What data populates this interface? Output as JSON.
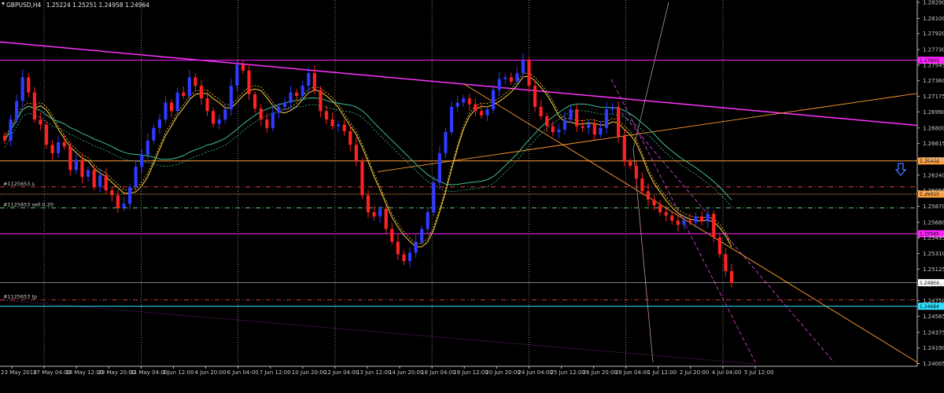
{
  "window": {
    "symbol_timeframe": "GBPUSD,H4",
    "ohlc": "1.25224 1.25251 1.24958 1.24964"
  },
  "chart_data": {
    "type": "candlestick",
    "symbol": "GBPUSD",
    "timeframe": "H4",
    "ylim": [
      1.24,
      1.2829
    ],
    "price_ticks": [
      "1.28290",
      "1.28100",
      "1.27920",
      "1.27730",
      "1.27545",
      "1.27360",
      "1.27175",
      "1.26990",
      "1.26800",
      "1.26615",
      "1.26430",
      "1.26240",
      "1.26055",
      "1.25870",
      "1.25680",
      "1.25495",
      "1.25310",
      "1.25125",
      "1.24940",
      "1.24750",
      "1.24565",
      "1.24375",
      "1.24190",
      "1.24005"
    ],
    "time_ticks": [
      "23 May 2019",
      "27 May 04:00",
      "28 May 12:00",
      "29 May 20:00",
      "31 May 04:00",
      "3 Jun 12:00",
      "4 Jun 20:00",
      "6 Jun 04:00",
      "7 Jun 12:00",
      "10 Jun 20:00",
      "12 Jun 04:00",
      "13 Jun 12:00",
      "14 Jun 20:00",
      "18 Jun 04:00",
      "19 Jun 12:00",
      "20 Jun 20:00",
      "24 Jun 04:00",
      "25 Jun 12:00",
      "26 Jun 20:00",
      "28 Jun 04:00",
      "1 Jul 12:00",
      "2 Jul 20:00",
      "4 Jul 04:00",
      "5 Jul 12:00"
    ],
    "candles_close": [
      1.2665,
      1.269,
      1.2712,
      1.274,
      1.2722,
      1.269,
      1.2684,
      1.266,
      1.265,
      1.2663,
      1.2658,
      1.263,
      1.2642,
      1.2622,
      1.263,
      1.261,
      1.2624,
      1.2606,
      1.26,
      1.2585,
      1.259,
      1.261,
      1.2634,
      1.2648,
      1.2665,
      1.268,
      1.269,
      1.271,
      1.27,
      1.2722,
      1.2718,
      1.274,
      1.273,
      1.2715,
      1.27,
      1.2685,
      1.269,
      1.2702,
      1.273,
      1.2755,
      1.2748,
      1.272,
      1.2703,
      1.269,
      1.268,
      1.2698,
      1.2705,
      1.271,
      1.2722,
      1.2718,
      1.273,
      1.2745,
      1.2725,
      1.27,
      1.269,
      1.2682,
      1.2684,
      1.2676,
      1.266,
      1.264,
      1.26,
      1.258,
      1.2575,
      1.2584,
      1.256,
      1.2545,
      1.253,
      1.2522,
      1.2532,
      1.2545,
      1.256,
      1.258,
      1.2615,
      1.265,
      1.2675,
      1.2705,
      1.271,
      1.2715,
      1.2708,
      1.27,
      1.2695,
      1.2702,
      1.2725,
      1.2738,
      1.274,
      1.2735,
      1.2745,
      1.276,
      1.273,
      1.2705,
      1.2694,
      1.2682,
      1.2675,
      1.2678,
      1.269,
      1.2702,
      1.2682,
      1.268,
      1.2685,
      1.2672,
      1.268,
      1.2702,
      1.2705,
      1.267,
      1.264,
      1.2635,
      1.262,
      1.2605,
      1.2595,
      1.2588,
      1.258,
      1.2576,
      1.257,
      1.2565,
      1.257,
      1.2568,
      1.2575,
      1.2569,
      1.2578,
      1.255,
      1.253,
      1.251,
      1.2496
    ],
    "horizontal_levels": [
      {
        "label": "1.27603",
        "price": 1.27603,
        "color": "#ff22ff"
      },
      {
        "label": "1.26408",
        "price": 1.26408,
        "color": "#ffa040"
      },
      {
        "label": "1.26015",
        "price": 1.26015,
        "color": "#ffa040"
      },
      {
        "label": "1.25545",
        "price": 1.25545,
        "color": "#ff22ff"
      },
      {
        "label": "1.24964",
        "price": 1.24964,
        "color": "#ffffff"
      },
      {
        "label": "1.24684",
        "price": 1.24684,
        "color": "#30e0ff"
      }
    ],
    "order_lines": [
      {
        "label": "#1125653 s",
        "price": 1.261,
        "color": "#ff4a4a"
      },
      {
        "label": "#1125653 sell 0.20",
        "price": 1.2585,
        "color": "#8aff8a"
      },
      {
        "label": "#1125653 tp",
        "price": 1.2476,
        "color": "#ff4a4a"
      }
    ],
    "colors": {
      "bull": "#2f3bff",
      "bear": "#ff2222",
      "grid": "#dddddd",
      "background": "#000000",
      "ma_fast": "#ffd23a",
      "ma_slow": "#3fbf8f",
      "trend": "#ff33ff",
      "channel": "#ff9a30"
    }
  },
  "icons": {
    "signal_arrow": "down-arrow-icon"
  }
}
